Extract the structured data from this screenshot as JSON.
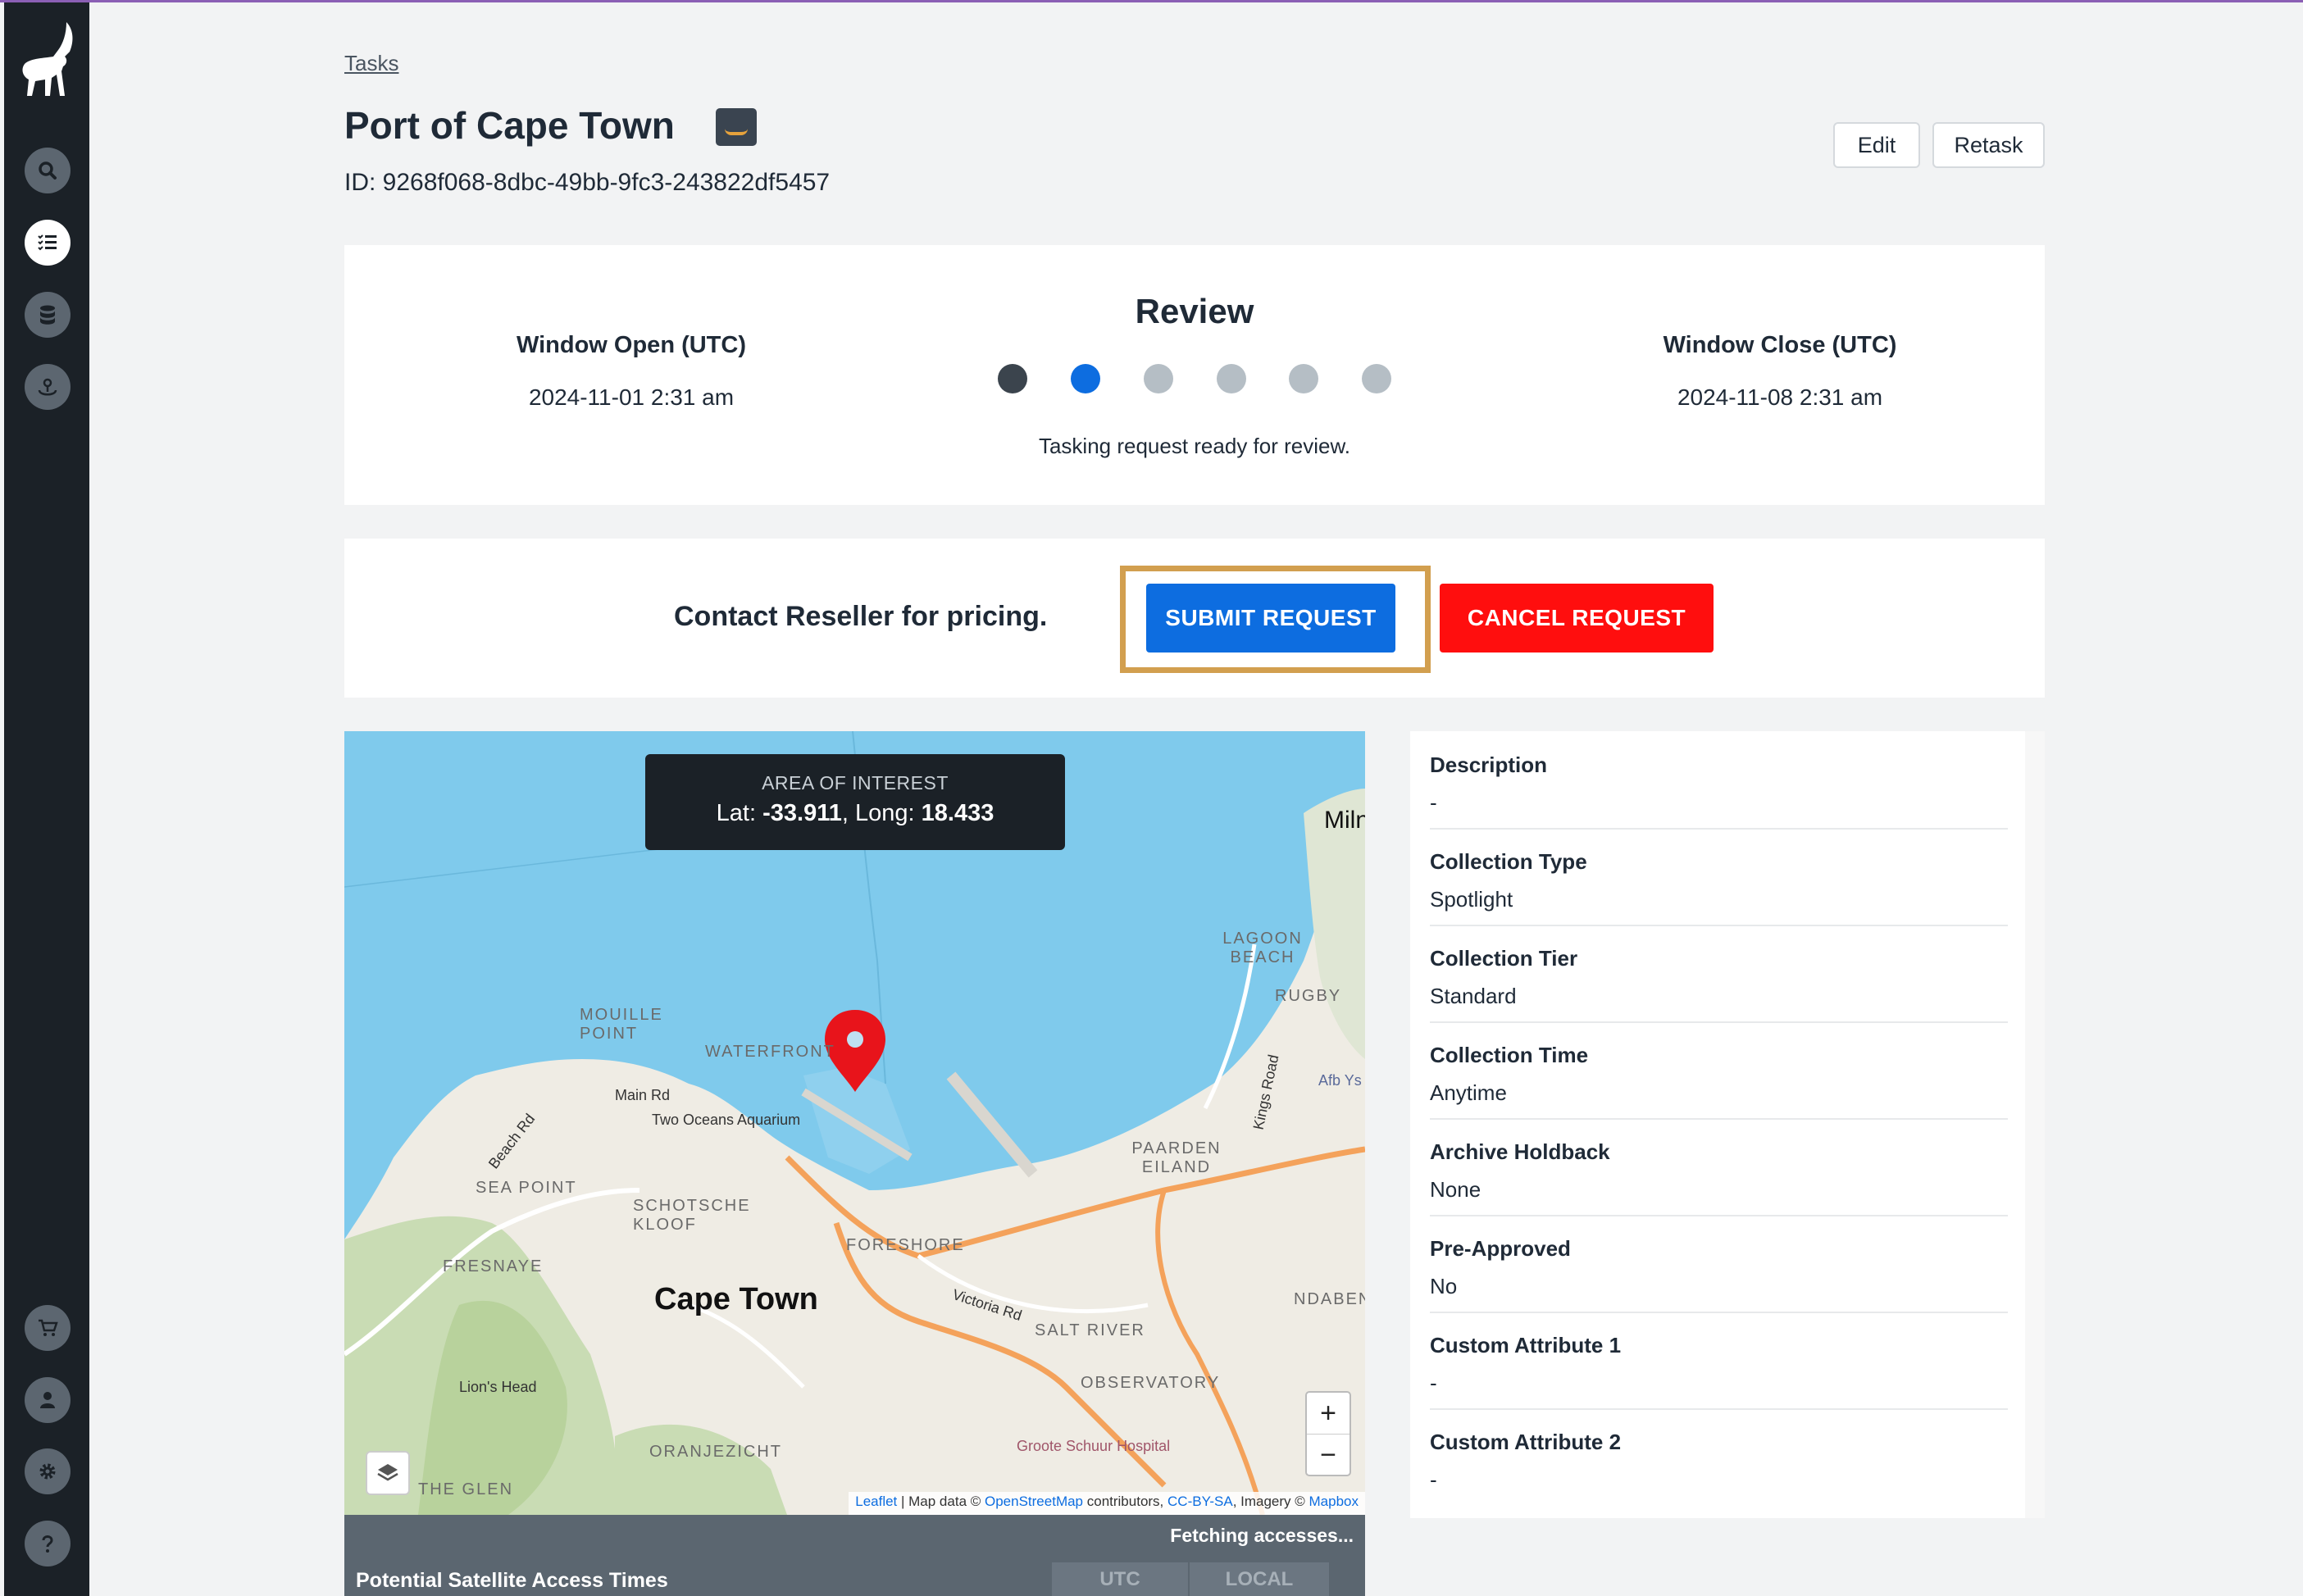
{
  "breadcrumb": "Tasks",
  "task": {
    "title": "Port of Cape Town",
    "id": "ID: 9268f068-8dbc-49bb-9fc3-243822df5457"
  },
  "header_buttons": {
    "edit": "Edit",
    "retask": "Retask"
  },
  "status": {
    "window_open_label": "Window Open (UTC)",
    "window_open_value": "2024-11-01 2:31 am",
    "window_close_label": "Window Close (UTC)",
    "window_close_value": "2024-11-08 2:31 am",
    "step_title": "Review",
    "step_caption": "Tasking request ready for review.",
    "steps_total": 6,
    "current_step": 2
  },
  "actions": {
    "pricing_text": "Contact Reseller for pricing.",
    "submit": "SUBMIT REQUEST",
    "cancel": "CANCEL REQUEST"
  },
  "map": {
    "aoi_title": "AREA OF INTEREST",
    "lat_label": "Lat:",
    "lat_value": "-33.911",
    "long_label": "Long:",
    "long_value": "18.433",
    "labels": {
      "city": "Cape Town",
      "mouille_point": "MOUILLE POINT",
      "waterfront": "WATERFRONT",
      "two_oceans": "Two Oceans Aquarium",
      "main_rd": "Main Rd",
      "beach_rd": "Beach Rd",
      "sea_point": "SEA POINT",
      "schotsche": "SCHOTSCHE KLOOF",
      "fresnaye": "FRESNAYE",
      "foreshore": "FORESHORE",
      "victoria_rd": "Victoria Rd",
      "salt_river": "SALT RIVER",
      "observatory": "OBSERVATORY",
      "paarden": "PAARDEN EILAND",
      "lagoon": "LAGOON BEACH",
      "rugby": "RUGBY",
      "milnerton": "Miln",
      "kings_road": "Kings Road",
      "afb": "Afb Ys",
      "ndabeni": "NDABEN",
      "lions_head": "Lion's Head",
      "oranjezicht": "ORANJEZICHT",
      "groote": "Groote Schuur Hospital",
      "the_glen": "THE GLEN"
    },
    "zoom_in": "+",
    "zoom_out": "−",
    "attribution": {
      "leaflet": "Leaflet",
      "mid1": " | Map data © ",
      "osm": "OpenStreetMap",
      "mid2": " contributors, ",
      "license": "CC-BY-SA",
      "mid3": ", Imagery © ",
      "mapbox": "Mapbox"
    }
  },
  "access": {
    "fetching": "Fetching accesses...",
    "title": "Potential Satellite Access Times",
    "utc": "UTC",
    "local": "LOCAL"
  },
  "details": [
    {
      "key": "Description",
      "value": "-"
    },
    {
      "key": "Collection Type",
      "value": "Spotlight"
    },
    {
      "key": "Collection Tier",
      "value": "Standard"
    },
    {
      "key": "Collection Time",
      "value": "Anytime"
    },
    {
      "key": "Archive Holdback",
      "value": "None"
    },
    {
      "key": "Pre-Approved",
      "value": "No"
    },
    {
      "key": "Custom Attribute 1",
      "value": "-"
    },
    {
      "key": "Custom Attribute 2",
      "value": "-"
    }
  ],
  "sidebar": {
    "items": [
      {
        "icon": "search-icon"
      },
      {
        "icon": "tasks-list-icon"
      },
      {
        "icon": "database-icon"
      },
      {
        "icon": "satellite-icon"
      },
      {
        "icon": "cart-icon"
      },
      {
        "icon": "user-icon"
      },
      {
        "icon": "gear-icon"
      },
      {
        "icon": "help-icon"
      }
    ]
  },
  "colors": {
    "primary": "#0d6de0",
    "danger": "#ff0e0e",
    "highlight": "#d29f4f",
    "sidebar": "#1b2127"
  }
}
